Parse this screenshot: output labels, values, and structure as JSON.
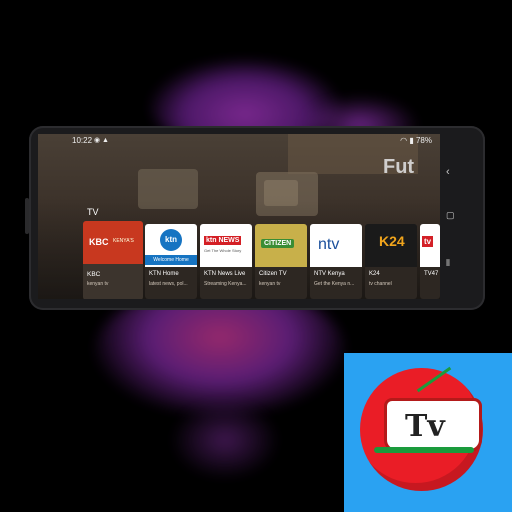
{
  "status": {
    "time": "10:22",
    "battery": "78%"
  },
  "hero": {
    "title": "Fut"
  },
  "section": {
    "title": "TV"
  },
  "channels": [
    {
      "name": "KBC",
      "desc": "kenyan tv",
      "logo_main": "KBC",
      "logo_sub": "KENYA'S"
    },
    {
      "name": "KTN Home",
      "desc": "latest news, pol...",
      "logo_main": "ktn",
      "logo_sub": "Welcome Home"
    },
    {
      "name": "KTN News Live",
      "desc": "Streaming Kenya...",
      "logo_main": "ktn NEWS",
      "logo_sub": "Get The Whole Story"
    },
    {
      "name": "Citizen TV",
      "desc": "kenyan tv",
      "logo_main": "CITIZEN",
      "logo_sub": ""
    },
    {
      "name": "NTV Kenya",
      "desc": "Get the Kenya n...",
      "logo_main": "ntv",
      "logo_sub": ""
    },
    {
      "name": "K24",
      "desc": "tv channel",
      "logo_main": "K24",
      "logo_sub": ""
    },
    {
      "name": "TV47",
      "desc": "",
      "logo_main": "tv",
      "logo_sub": ""
    }
  ],
  "nav": {
    "back_icon": "chevron-left-icon",
    "home_icon": "rounded-square-icon",
    "recents_icon": "triple-bar-icon"
  },
  "app_icon": {
    "label": "Tv"
  }
}
